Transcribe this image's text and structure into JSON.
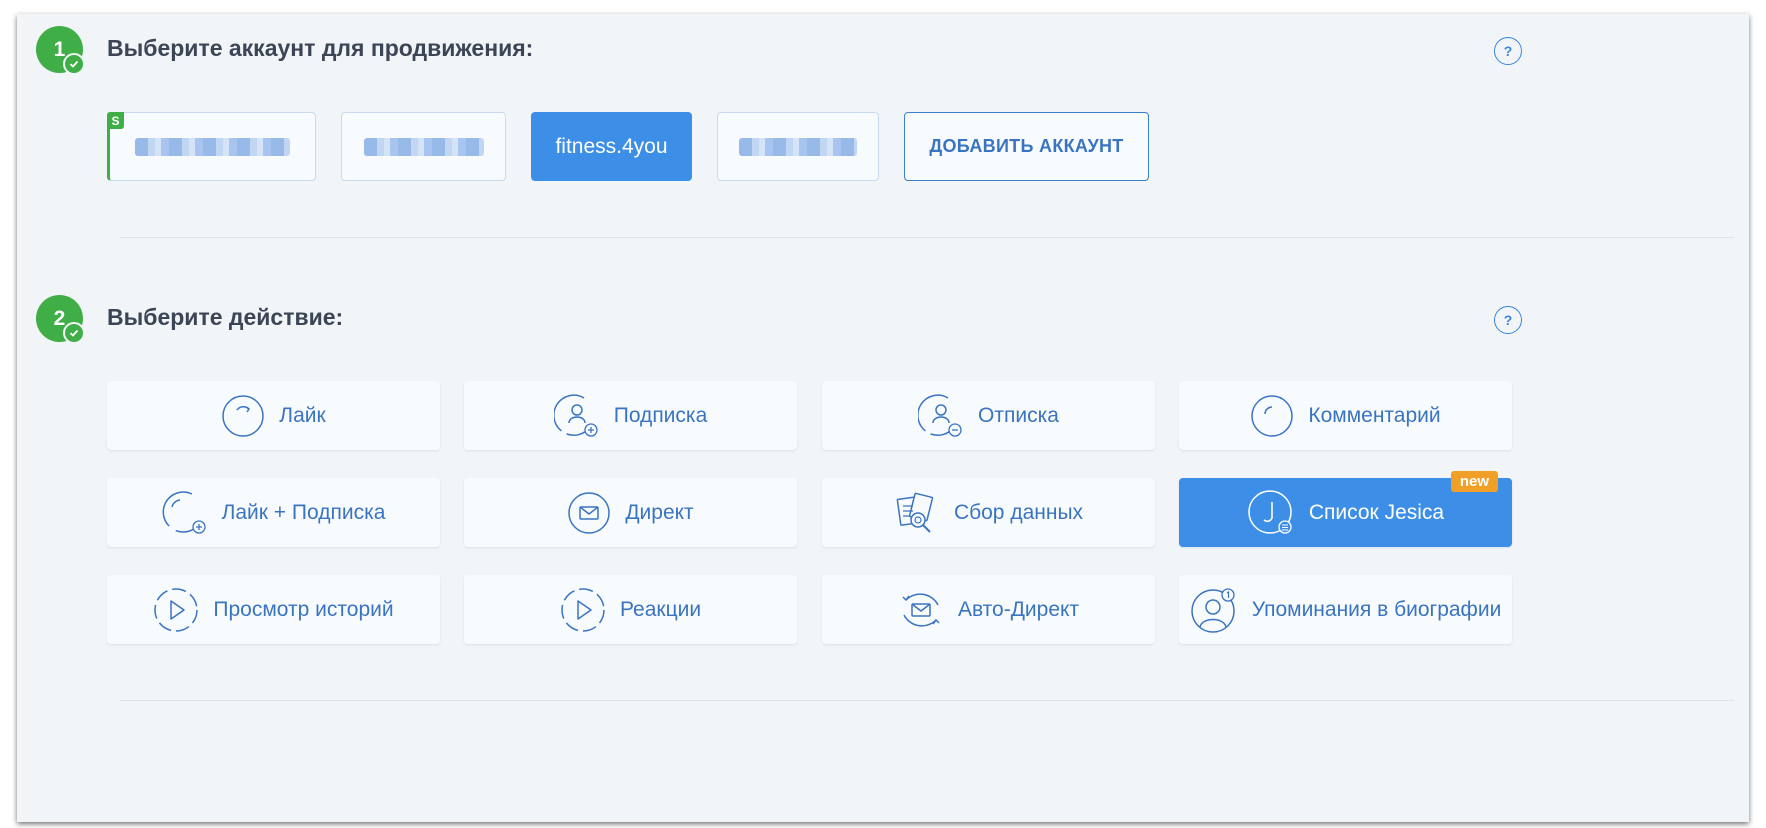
{
  "step1": {
    "number": "1",
    "title": "Выберите аккаунт для продвижения:",
    "help": "?"
  },
  "accounts": [
    {
      "label": "",
      "badge": "S"
    },
    {
      "label": ""
    },
    {
      "label": "fitness.4you"
    },
    {
      "label": ""
    }
  ],
  "add_account_label": "ДОБАВИТЬ АККАУНТ",
  "step2": {
    "number": "2",
    "title": "Выберите действие:",
    "help": "?"
  },
  "actions": [
    {
      "label": "Лайк",
      "icon": "refresh-circle-icon"
    },
    {
      "label": "Подписка",
      "icon": "user-plus-icon"
    },
    {
      "label": "Отписка",
      "icon": "user-minus-icon"
    },
    {
      "label": "Комментарий",
      "icon": "comment-icon"
    },
    {
      "label": "Лайк + Подписка",
      "icon": "like-follow-icon"
    },
    {
      "label": "Директ",
      "icon": "mail-circle-icon"
    },
    {
      "label": "Сбор данных",
      "icon": "data-collect-icon"
    },
    {
      "label": "Список Jesica",
      "icon": "jesica-list-icon",
      "badge": "new"
    },
    {
      "label": "Просмотр историй",
      "icon": "story-play-icon"
    },
    {
      "label": "Реакции",
      "icon": "reaction-play-icon"
    },
    {
      "label": "Авто-Директ",
      "icon": "auto-direct-icon"
    },
    {
      "label": "Упоминания в биографии",
      "icon": "bio-mention-icon"
    }
  ],
  "colors": {
    "accent": "#3d8ee6",
    "green": "#3fae47",
    "new_badge": "#f0a026",
    "panel_bg": "#f1f5f8"
  }
}
